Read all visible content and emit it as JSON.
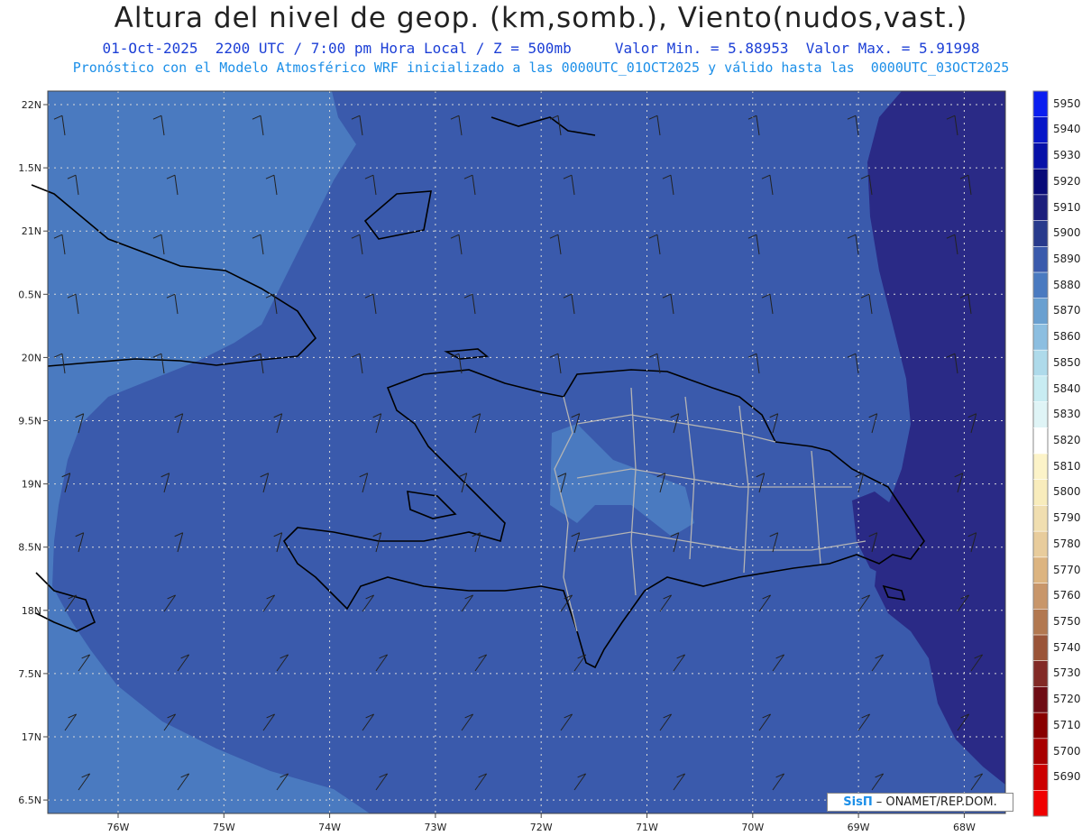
{
  "header": {
    "title": "Altura del nivel de geop. (km,somb.), Viento(nudos,vast.)",
    "subtitle_line1": "01-Oct-2025  2200 UTC / 7:00 pm Hora Local / Z = 500mb     Valor Min. = 5.88953  Valor Max. = 5.91998",
    "subtitle_line2": "Pronóstico con el Modelo Atmosférico WRF inicializado a las 0000UTC_01OCT2025 y válido hasta las  0000UTC_03OCT2025"
  },
  "axes": {
    "lat_labels": [
      "22N",
      "1.5N",
      "21N",
      "0.5N",
      "20N",
      "9.5N",
      "19N",
      "8.5N",
      "18N",
      "7.5N",
      "17N",
      "6.5N"
    ],
    "lon_labels": [
      "76W",
      "75W",
      "74W",
      "73W",
      "72W",
      "71W",
      "70W",
      "69W",
      "68W"
    ]
  },
  "colorbar": {
    "labels": [
      "5950",
      "5940",
      "5930",
      "5920",
      "5910",
      "5900",
      "5890",
      "5880",
      "5870",
      "5860",
      "5850",
      "5840",
      "5830",
      "5820",
      "5810",
      "5800",
      "5790",
      "5780",
      "5770",
      "5760",
      "5750",
      "5740",
      "5730",
      "5720",
      "5710",
      "5700",
      "5690"
    ],
    "colors": [
      "#0a1ef0",
      "#0616c8",
      "#0610a8",
      "#080a78",
      "#1c1e7c",
      "#283a8c",
      "#3a5aac",
      "#4a7ac0",
      "#6aa0d0",
      "#8cbee0",
      "#aedaea",
      "#c8ecf2",
      "#dff4f6",
      "#ffffff",
      "#fcf3c8",
      "#f8ecbc",
      "#f0deb0",
      "#e8cc9c",
      "#dcb480",
      "#c8966a",
      "#b27850",
      "#9a5438",
      "#822a26",
      "#6e0c14",
      "#880000",
      "#a80000",
      "#cc0000",
      "#f00000"
    ]
  },
  "map_colors": {
    "band_5890": "#4a7ac0",
    "band_5900": "#3a5aac",
    "band_5910": "#2a2a86",
    "land_outline": "#000000",
    "border_lines": "#b4b4b4"
  },
  "credit": {
    "logo": "SisΠ",
    "org": "– ONAMET/REP.DOM."
  }
}
